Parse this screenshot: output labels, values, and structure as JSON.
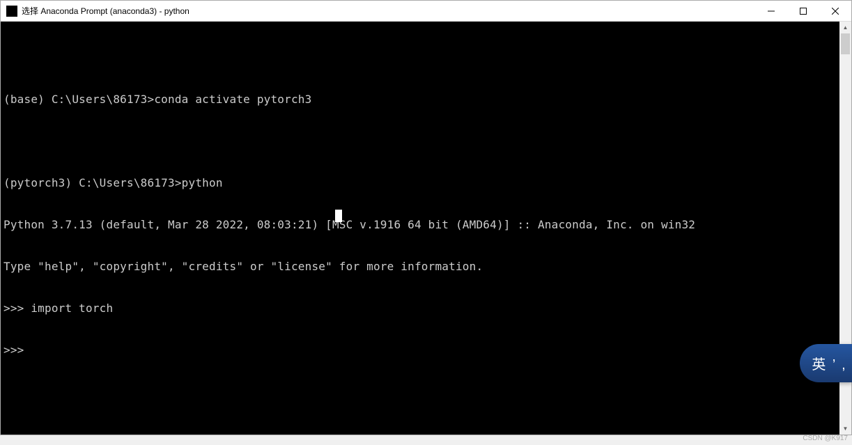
{
  "window": {
    "title": "选择 Anaconda Prompt (anaconda3) - python"
  },
  "terminal": {
    "lines": [
      "",
      "(base) C:\\Users\\86173>conda activate pytorch3",
      "",
      "(pytorch3) C:\\Users\\86173>python",
      "Python 3.7.13 (default, Mar 28 2022, 08:03:21) [MSC v.1916 64 bit (AMD64)] :: Anaconda, Inc. on win32",
      "Type \"help\", \"copyright\", \"credits\" or \"license\" for more information.",
      ">>> import torch",
      ">>>"
    ]
  },
  "ime": {
    "label": "英 ’ ,"
  },
  "watermark": "CSDN @K917"
}
